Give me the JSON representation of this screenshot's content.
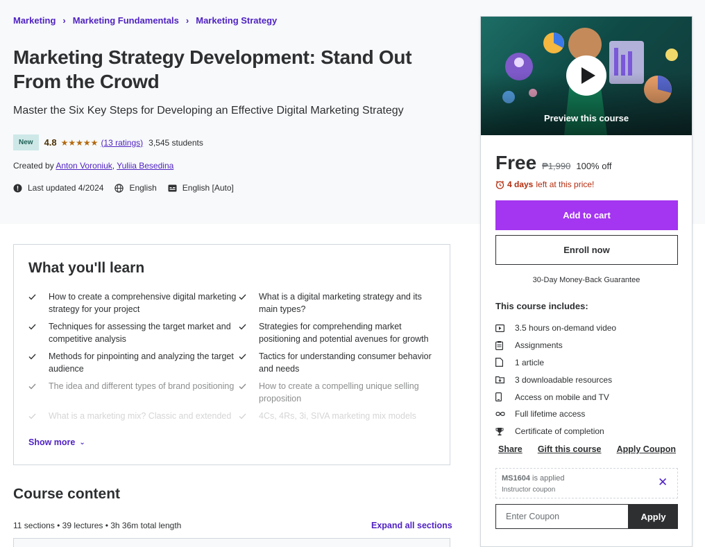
{
  "breadcrumb": {
    "items": [
      "Marketing",
      "Marketing Fundamentals",
      "Marketing Strategy"
    ]
  },
  "course": {
    "title": "Marketing Strategy Development: Stand Out From the Crowd",
    "subtitle": "Master the Six Key Steps for Developing an Effective Digital Marketing Strategy",
    "badge": "New",
    "rating": "4.8",
    "stars": "★★★★★",
    "ratings_count": "(13 ratings)",
    "students": "3,545 students",
    "created_by_label": "Created by",
    "authors": [
      "Anton Voroniuk",
      "Yuliia Besedina"
    ],
    "last_updated": "Last updated 4/2024",
    "language": "English",
    "captions": "English [Auto]"
  },
  "learn": {
    "title": "What you'll learn",
    "items": [
      "How to create a comprehensive digital marketing strategy for your project",
      "What is a digital marketing strategy and its main types?",
      "Techniques for assessing the target market and competitive analysis",
      "Strategies for comprehending market positioning and potential avenues for growth",
      "Methods for pinpointing and analyzing the target audience",
      "Tactics for understanding consumer behavior and needs",
      "The idea and different types of brand positioning",
      "How to create a compelling unique selling proposition",
      "What is a marketing mix? Classic and extended marketing mix models",
      "4Cs, 4Rs, 3i, SIVA marketing mix models"
    ],
    "show_more": "Show more"
  },
  "content": {
    "title": "Course content",
    "meta": "11 sections • 39 lectures • 3h 36m total length",
    "expand_all": "Expand all sections"
  },
  "sidebar": {
    "preview_label": "Preview this course",
    "price": "Free",
    "original_price": "₱1,990",
    "discount": "100% off",
    "timer_days": "4 days",
    "timer_text": "left at this price!",
    "add_to_cart": "Add to cart",
    "enroll_now": "Enroll now",
    "guarantee": "30-Day Money-Back Guarantee",
    "includes_title": "This course includes:",
    "includes": [
      {
        "icon": "video-icon",
        "text": "3.5 hours on-demand video"
      },
      {
        "icon": "assignment-icon",
        "text": "Assignments"
      },
      {
        "icon": "article-icon",
        "text": "1 article"
      },
      {
        "icon": "download-icon",
        "text": "3 downloadable resources"
      },
      {
        "icon": "mobile-icon",
        "text": "Access on mobile and TV"
      },
      {
        "icon": "infinity-icon",
        "text": "Full lifetime access"
      },
      {
        "icon": "trophy-icon",
        "text": "Certificate of completion"
      }
    ],
    "share": "Share",
    "gift": "Gift this course",
    "apply_coupon": "Apply Coupon",
    "coupon_code": "MS1604",
    "coupon_applied": "is applied",
    "coupon_type": "Instructor coupon",
    "coupon_placeholder": "Enter Coupon",
    "apply": "Apply"
  },
  "colors": {
    "accent": "#a435f0",
    "link": "#5022c3",
    "timer": "#b32d0f",
    "badge_bg": "#cee8e8",
    "star": "#b4690e"
  }
}
